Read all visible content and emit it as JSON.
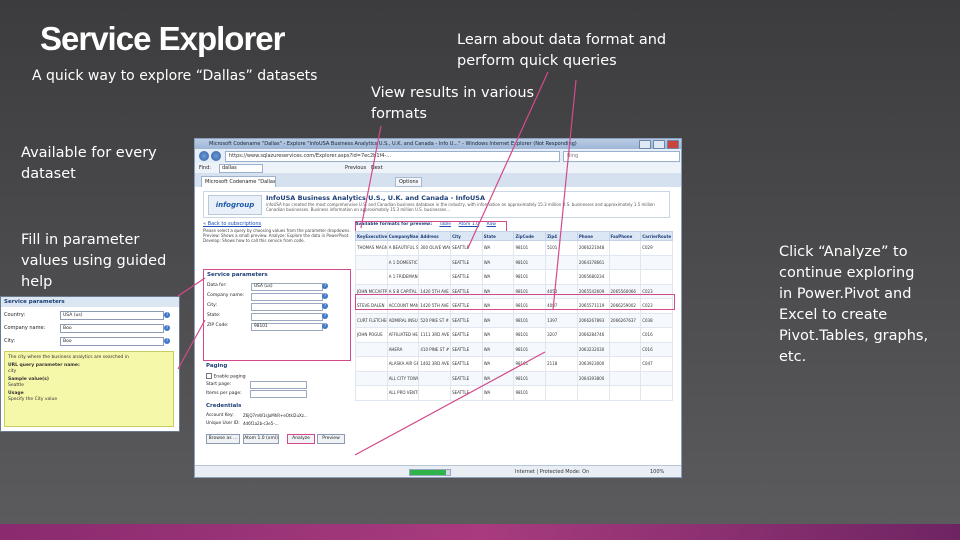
{
  "slide": {
    "title": "Service Explorer",
    "subtitle": "A quick way to explore “Dallas” datasets",
    "callouts": {
      "learn": "Learn about data format and perform quick queries",
      "view_results": "View results in various formats",
      "available": "Available for every dataset",
      "fill_params": "Fill in parameter values using guided help",
      "analyze": "Click “Analyze” to continue exploring in Power.Pivot and Excel to create Pivot.Tables, graphs, etc."
    },
    "accent_color": "#d24a8b"
  },
  "browser": {
    "title": "Microsoft Codename \"Dallas\" - Explore \"InfoUSA Business Analytics U.S., U.K. and Canada - Info U...\" - Windows Internet Explorer (Not Responding)",
    "url": "https://www.sqlazureservices.com/Explorer.aspx?id=7ec2b1f4-...",
    "search_placeholder": "Bing",
    "tab_label": "Microsoft Codename \"Dallas\" - Explore \"InfoUSA ...\"",
    "find_label": "Find:",
    "find_value": "dallas",
    "prev_label": "Previous",
    "next_label": "Next",
    "options_label": "Options",
    "status_text": "Internet | Protected Mode: On",
    "zoom": "100%",
    "progress": 0.9
  },
  "page": {
    "logo": "infogroup",
    "heading": "InfoUSA Business Analytics U.S., U.K. and Canada - InfoUSA",
    "description": "infoUSA has created the most comprehensive U.S. and Canadian business database in the industry, with information on approximately 15.3 million U.S. businesses and approximately 1.5 million Canadian businesses. Business information on approximately 15.3 million U.S. businesses...",
    "back_link": "« Back to subscriptions",
    "intro": "Please select a query by choosing values from the parameter dropdowns. Preview: Shows a small preview. Analyze: Explore the data in PowerPivot. Develop: Shows how to call this service from code.",
    "service_parameters": {
      "heading": "Service parameters",
      "rows": [
        {
          "label": "Data for:",
          "value": "USA (us)"
        },
        {
          "label": "Company name:",
          "value": ""
        },
        {
          "label": "City:",
          "value": ""
        },
        {
          "label": "State:",
          "value": ""
        },
        {
          "label": "ZIP Code:",
          "value": "98101"
        }
      ]
    },
    "paging": {
      "heading": "Paging",
      "enable": "Enable paging",
      "start_page": "Start page:",
      "items_per_page": "Items per page:"
    },
    "credentials": {
      "heading": "Credentials",
      "account_key_label": "Account Key:",
      "account_key": "Z6jQ7mW1sJaMhR+eOtkl2uXz...",
      "user_id_label": "Unique User ID:",
      "user_id": "4d6f1a2b-c3e5-..."
    },
    "buttons": {
      "browse": "Browse as ...",
      "atom": "Atom 1.0 (xml)",
      "analyze": "Analyze",
      "preview": "Preview"
    },
    "formats": {
      "label": "Available formats for preview:",
      "options": [
        "Table",
        "Atom 1.0",
        "Raw"
      ]
    },
    "results": {
      "columns": [
        "KeyExecutive",
        "CompanyName",
        "Address",
        "City",
        "State",
        "ZipCode",
        "Zip4",
        "Phone",
        "FaxPhone",
        "CarrierRoute"
      ],
      "rows": [
        [
          "THOMAS MAGNUSSON",
          "A BEAUTIFUL SMILE",
          "300 OLIVE WAY",
          "SEATTLE",
          "WA",
          "98101",
          "5101",
          "2066221048",
          "",
          "C029"
        ],
        [
          "",
          "A 1 DOMESTIC REFRIGERATION SVC",
          "",
          "SEATTLE",
          "WA",
          "98101",
          "",
          "2064378661",
          "",
          ""
        ],
        [
          "",
          "A 1 FRIDEMAN AWS BUILDING CONSTRUCTION",
          "",
          "SEATTLE",
          "WA",
          "98101",
          "",
          "2065680234",
          "",
          ""
        ],
        [
          "JOHN MCCAFFREY",
          "A S B CAPITAL MANAGEMENT",
          "1420 5TH AVE # 3000",
          "SEATTLE",
          "WA",
          "98101",
          "4050",
          "2065542609",
          "2065560066",
          "C023"
        ],
        [
          "STEVE DALEN",
          "ACCOUNT MANAGEMENT GROUP",
          "1420 5TH AVE # 2200",
          "SEATTLE",
          "WA",
          "98101",
          "4087",
          "2065571119",
          "2066259002",
          "C023"
        ],
        [
          "CURT FLETCHER",
          "ADMIRAL INSURANCE CO",
          "520 PIKE ST # 2609",
          "SEATTLE",
          "WA",
          "98101",
          "1397",
          "2066267893",
          "2066267637",
          "C038"
        ],
        [
          "JOHN POGUE",
          "AFFILIATED HEALTH SVC OF SEATTLE",
          "1111 3RD AVE # 1125",
          "SEATTLE",
          "WA",
          "98101",
          "3207",
          "2066284746",
          "",
          "C016"
        ],
        [
          "",
          "AHERA",
          "410 PINE ST # 200",
          "SEATTLE",
          "WA",
          "98101",
          "",
          "2063232030",
          "",
          "C016"
        ],
        [
          "",
          "ALASKA AIR GROUP",
          "1402 3RD AVE # 6000",
          "SEATTLE",
          "WA",
          "98101",
          "2118",
          "2063923000",
          "",
          "C047"
        ],
        [
          "",
          "ALL CITY TOWING",
          "",
          "SEATTLE",
          "WA",
          "98101",
          "",
          "2064393800",
          "",
          ""
        ],
        [
          "",
          "ALL PRO VENTILATION",
          "",
          "SEATTLE",
          "WA",
          "98101",
          "",
          "",
          "",
          ""
        ]
      ]
    }
  },
  "popup": {
    "heading": "Service parameters",
    "rows": [
      {
        "label": "Country:",
        "value": "USA (us)"
      },
      {
        "label": "Company name:",
        "value": "Boo"
      },
      {
        "label": "City:",
        "value": "Boo"
      }
    ],
    "tip": {
      "line1": "The city where the business analytics are searched in",
      "line2": "URL query parameter name:",
      "line3": "city",
      "sample_label": "Sample value(s)",
      "sample_value": "Seattle",
      "usage_label": "Usage",
      "usage_value": "Specify the City value"
    }
  }
}
